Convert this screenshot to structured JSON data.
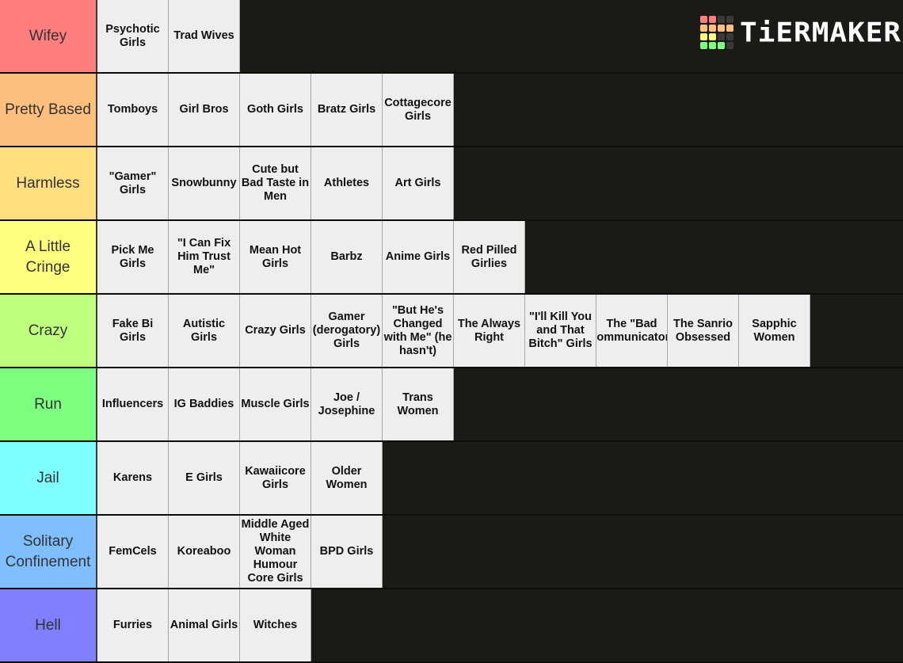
{
  "logo": {
    "text": "TiERMAKER",
    "grid_colors": [
      "#ff7f7f",
      "#ff7f7f",
      "#3a3a3a",
      "#3a3a3a",
      "#ffbf7f",
      "#ffbf7f",
      "#ffbf7f",
      "#ffbf7f",
      "#ffff7f",
      "#ffff7f",
      "#3a3a3a",
      "#3a3a3a",
      "#7fff7f",
      "#7fff7f",
      "#7fff7f",
      "#3a3a3a"
    ]
  },
  "tiers": [
    {
      "label": "Wifey",
      "color": "#ff7f7f",
      "items": [
        "Psychotic Girls",
        "Trad Wives"
      ]
    },
    {
      "label": "Pretty Based",
      "color": "#ffbf7f",
      "items": [
        "Tomboys",
        "Girl Bros",
        "Goth Girls",
        "Bratz Girls",
        "Cottagecore Girls"
      ]
    },
    {
      "label": "Harmless",
      "color": "#ffdf7f",
      "items": [
        "\"Gamer\" Girls",
        "Snowbunny",
        "Cute but Bad Taste in Men",
        "Athletes",
        "Art Girls"
      ]
    },
    {
      "label": "A Little Cringe",
      "color": "#ffff7f",
      "items": [
        "Pick Me Girls",
        "\"I Can Fix Him Trust Me\"",
        "Mean Hot Girls",
        "Barbz",
        "Anime Girls",
        "Red Pilled Girlies"
      ]
    },
    {
      "label": "Crazy",
      "color": "#bfff7f",
      "items": [
        "Fake Bi Girls",
        "Autistic Girls",
        "Crazy Girls",
        "Gamer (derogatory) Girls",
        "\"But He's Changed with Me\" (he hasn't)",
        "The Always Right",
        "\"I'll Kill You and That Bitch\" Girls",
        "The \"Bad Communicator\"",
        "The Sanrio Obsessed",
        "Sapphic Women"
      ]
    },
    {
      "label": "Run",
      "color": "#7fff7f",
      "items": [
        "Influencers",
        "IG Baddies",
        "Muscle Girls",
        "Joe / Josephine",
        "Trans Women"
      ]
    },
    {
      "label": "Jail",
      "color": "#7fffff",
      "items": [
        "Karens",
        "E Girls",
        "Kawaiicore Girls",
        "Older Women"
      ]
    },
    {
      "label": "Solitary Confinement",
      "color": "#7fbfff",
      "items": [
        "FemCels",
        "Koreaboo",
        "Middle Aged White Woman Humour Core Girls",
        "BPD Girls"
      ]
    },
    {
      "label": "Hell",
      "color": "#7f7fff",
      "items": [
        "Furries",
        "Animal Girls",
        "Witches"
      ]
    }
  ]
}
